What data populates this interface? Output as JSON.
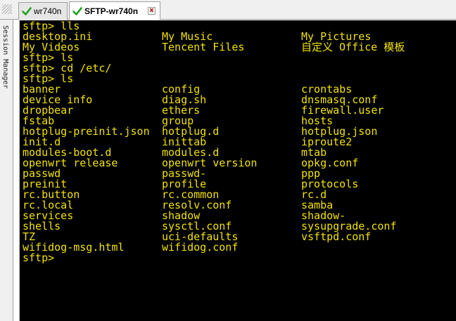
{
  "tabs": [
    {
      "label": "wr740n",
      "active": false,
      "status_icon": "check-icon"
    },
    {
      "label": "SFTP-wr740n",
      "active": true,
      "status_icon": "check-icon",
      "close_icon": "close-icon"
    }
  ],
  "session_manager": {
    "label": "Session Manager"
  },
  "colors": {
    "terminal_bg": "#000000",
    "terminal_fg": "#f2e200",
    "check": "#1aa31a"
  },
  "terminal": {
    "lines": [
      {
        "type": "cmd",
        "text": "sftp> lls"
      },
      {
        "type": "cols",
        "cells": [
          "desktop.ini",
          "My Music",
          "My Pictures"
        ]
      },
      {
        "type": "cols",
        "cells": [
          "My Videos",
          "Tencent Files",
          "自定义 Office 模板"
        ]
      },
      {
        "type": "cmd",
        "text": "sftp> ls"
      },
      {
        "type": "cmd",
        "text": "sftp> cd /etc/"
      },
      {
        "type": "cmd",
        "text": "sftp> ls"
      },
      {
        "type": "cols",
        "cells": [
          "banner",
          "config",
          "crontabs"
        ]
      },
      {
        "type": "cols",
        "cells": [
          "device_info",
          "diag.sh",
          "dnsmasq.conf"
        ]
      },
      {
        "type": "cols",
        "cells": [
          "dropbear",
          "ethers",
          "firewall.user"
        ]
      },
      {
        "type": "cols",
        "cells": [
          "fstab",
          "group",
          "hosts"
        ]
      },
      {
        "type": "cols",
        "cells": [
          "hotplug-preinit.json",
          "hotplug.d",
          "hotplug.json"
        ]
      },
      {
        "type": "cols",
        "cells": [
          "init.d",
          "inittab",
          "iproute2"
        ]
      },
      {
        "type": "cols",
        "cells": [
          "modules-boot.d",
          "modules.d",
          "mtab"
        ]
      },
      {
        "type": "cols",
        "cells": [
          "openwrt_release",
          "openwrt_version",
          "opkg.conf"
        ]
      },
      {
        "type": "cols",
        "cells": [
          "passwd",
          "passwd-",
          "ppp"
        ]
      },
      {
        "type": "cols",
        "cells": [
          "preinit",
          "profile",
          "protocols"
        ]
      },
      {
        "type": "cols",
        "cells": [
          "rc.button",
          "rc.common",
          "rc.d"
        ]
      },
      {
        "type": "cols",
        "cells": [
          "rc.local",
          "resolv.conf",
          "samba"
        ]
      },
      {
        "type": "cols",
        "cells": [
          "services",
          "shadow",
          "shadow-"
        ]
      },
      {
        "type": "cols",
        "cells": [
          "shells",
          "sysctl.conf",
          "sysupgrade.conf"
        ]
      },
      {
        "type": "cols",
        "cells": [
          "TZ",
          "uci-defaults",
          "vsftpd.conf"
        ]
      },
      {
        "type": "cols",
        "cells": [
          "wifidog-msg.html",
          "wifidog.conf",
          ""
        ]
      },
      {
        "type": "cmd",
        "text": "sftp>"
      }
    ]
  }
}
